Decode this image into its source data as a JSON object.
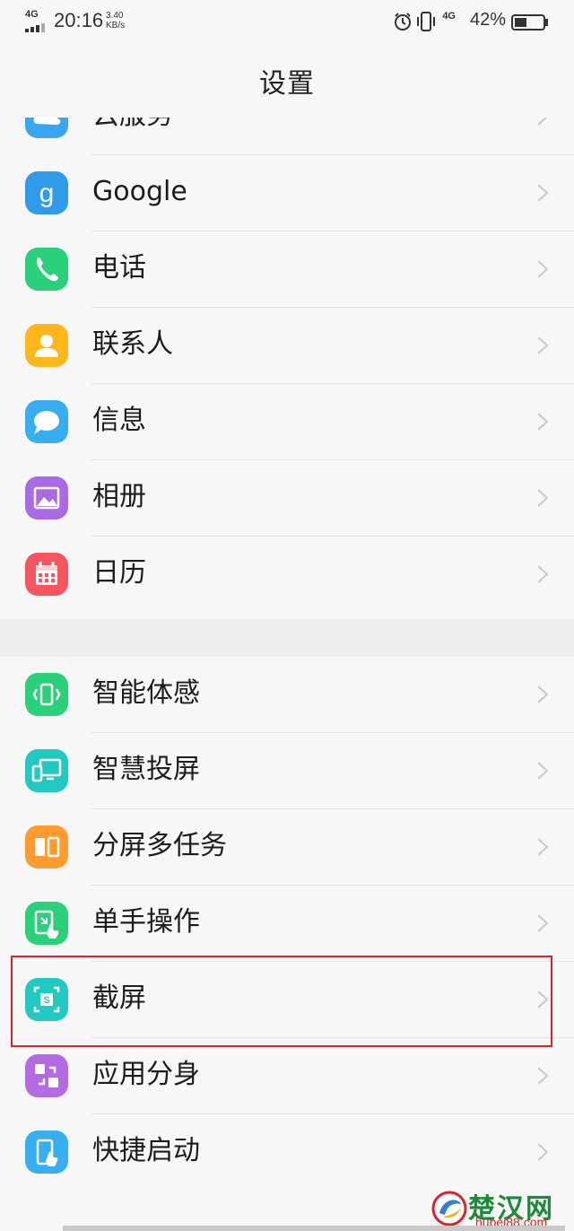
{
  "status_bar": {
    "network": "4G",
    "time": "20:16",
    "speed_value": "3.40",
    "speed_unit": "KB/s",
    "network_right": "4G",
    "battery_percent": "42%",
    "battery_level": 0.42
  },
  "header": {
    "title": "设置"
  },
  "groups": [
    {
      "items": [
        {
          "label": "云服务",
          "icon": "cloud-service-icon",
          "color": "#3ba6f0"
        },
        {
          "label": "Google",
          "icon": "google-icon",
          "color": "#2f9be9"
        },
        {
          "label": "电话",
          "icon": "phone-icon",
          "color": "#2bd07a"
        },
        {
          "label": "联系人",
          "icon": "contacts-icon",
          "color": "#ffb61a"
        },
        {
          "label": "信息",
          "icon": "messages-icon",
          "color": "#37aef0"
        },
        {
          "label": "相册",
          "icon": "gallery-icon",
          "color": "#a86be4"
        },
        {
          "label": "日历",
          "icon": "calendar-icon",
          "color": "#f6545f"
        }
      ]
    },
    {
      "items": [
        {
          "label": "智能体感",
          "icon": "motion-sense-icon",
          "color": "#2bd07a"
        },
        {
          "label": "智慧投屏",
          "icon": "screen-cast-icon",
          "color": "#22c9c1"
        },
        {
          "label": "分屏多任务",
          "icon": "split-screen-icon",
          "color": "#ff9b2f"
        },
        {
          "label": "单手操作",
          "icon": "one-hand-icon",
          "color": "#2bd07a"
        },
        {
          "label": "截屏",
          "icon": "screenshot-icon",
          "color": "#22c9c1"
        },
        {
          "label": "应用分身",
          "icon": "app-clone-icon",
          "color": "#b36be4"
        },
        {
          "label": "快捷启动",
          "icon": "quick-launch-icon",
          "color": "#37aef0"
        }
      ]
    }
  ],
  "watermark": {
    "text": "楚汉网",
    "sub": "hubei88.com"
  }
}
